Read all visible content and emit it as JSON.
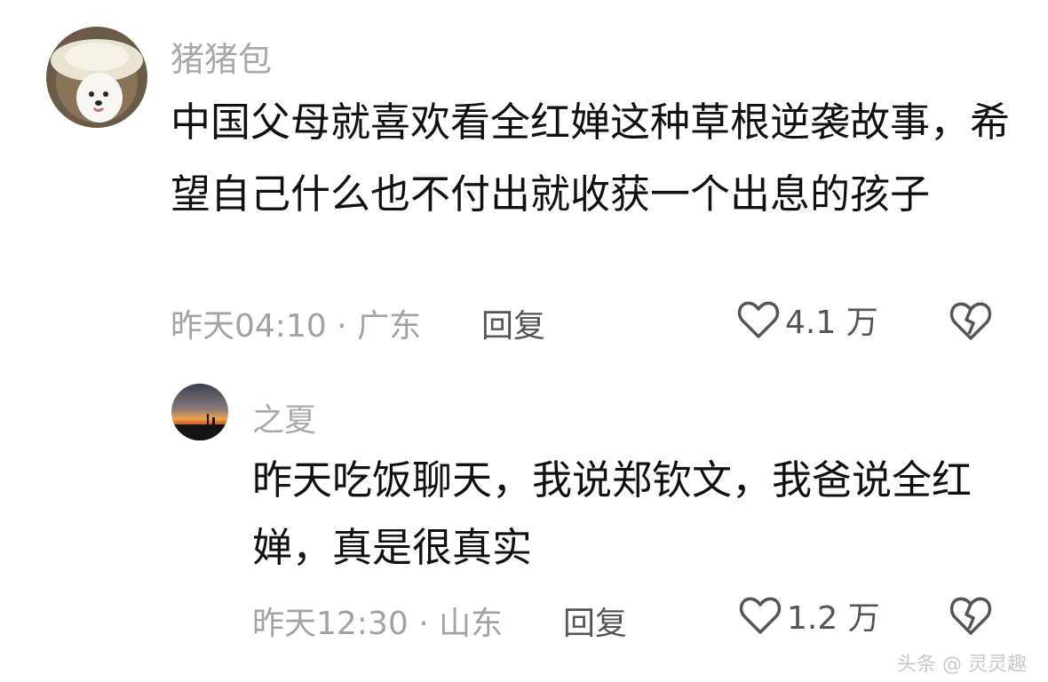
{
  "comments": [
    {
      "username": "猪猪包",
      "avatar_icon": "dog-in-hat-avatar",
      "text": "中国父母就喜欢看全红婵这种草根逆袭故事，希望自己什么也不付出就收获一个出息的孩子",
      "time_location": "昨天04:10 · 广东",
      "reply_label": "回复",
      "like_count": "4.1 万"
    },
    {
      "username": "之夏",
      "avatar_icon": "sunset-avatar",
      "text": "昨天吃饭聊天，我说郑钦文，我爸说全红婵，真是很真实",
      "time_location": "昨天12:30 · 山东",
      "reply_label": "回复",
      "like_count": "1.2 万"
    }
  ],
  "icons": {
    "like": "heart-outline-icon",
    "dislike": "broken-heart-icon"
  },
  "colors": {
    "meta_gray": "#a2a2a2",
    "body_text": "#111111",
    "username_gray": "#a9a9a9"
  },
  "watermark": "头条 @ 灵灵趣"
}
